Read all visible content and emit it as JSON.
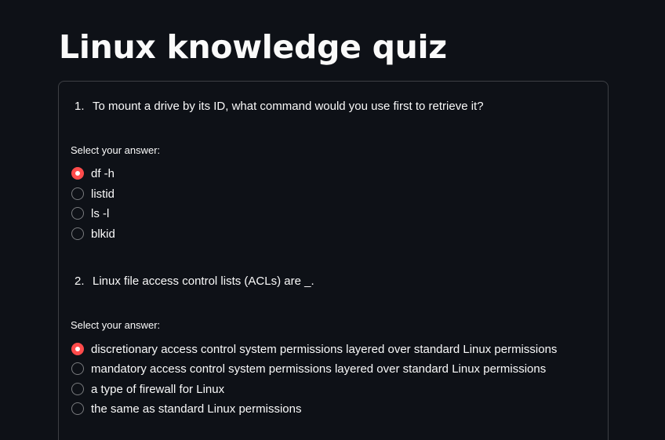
{
  "page": {
    "title": "Linux knowledge quiz"
  },
  "colors": {
    "background": "#0e1117",
    "text": "#fafafa",
    "accent": "#ff4b4b"
  },
  "questions": [
    {
      "number": "1.",
      "text": "To mount a drive by its ID, what command would you use first to retrieve it?",
      "select_label": "Select your answer:",
      "selected_index": 0,
      "options": [
        "df -h",
        "listid",
        "ls -l",
        "blkid"
      ]
    },
    {
      "number": "2.",
      "text": "Linux file access control lists (ACLs) are _.",
      "select_label": "Select your answer:",
      "selected_index": 0,
      "options": [
        "discretionary access control system permissions layered over standard Linux permissions",
        "mandatory access control system permissions layered over standard Linux permissions",
        "a type of firewall for Linux",
        "the same as standard Linux permissions"
      ]
    }
  ]
}
